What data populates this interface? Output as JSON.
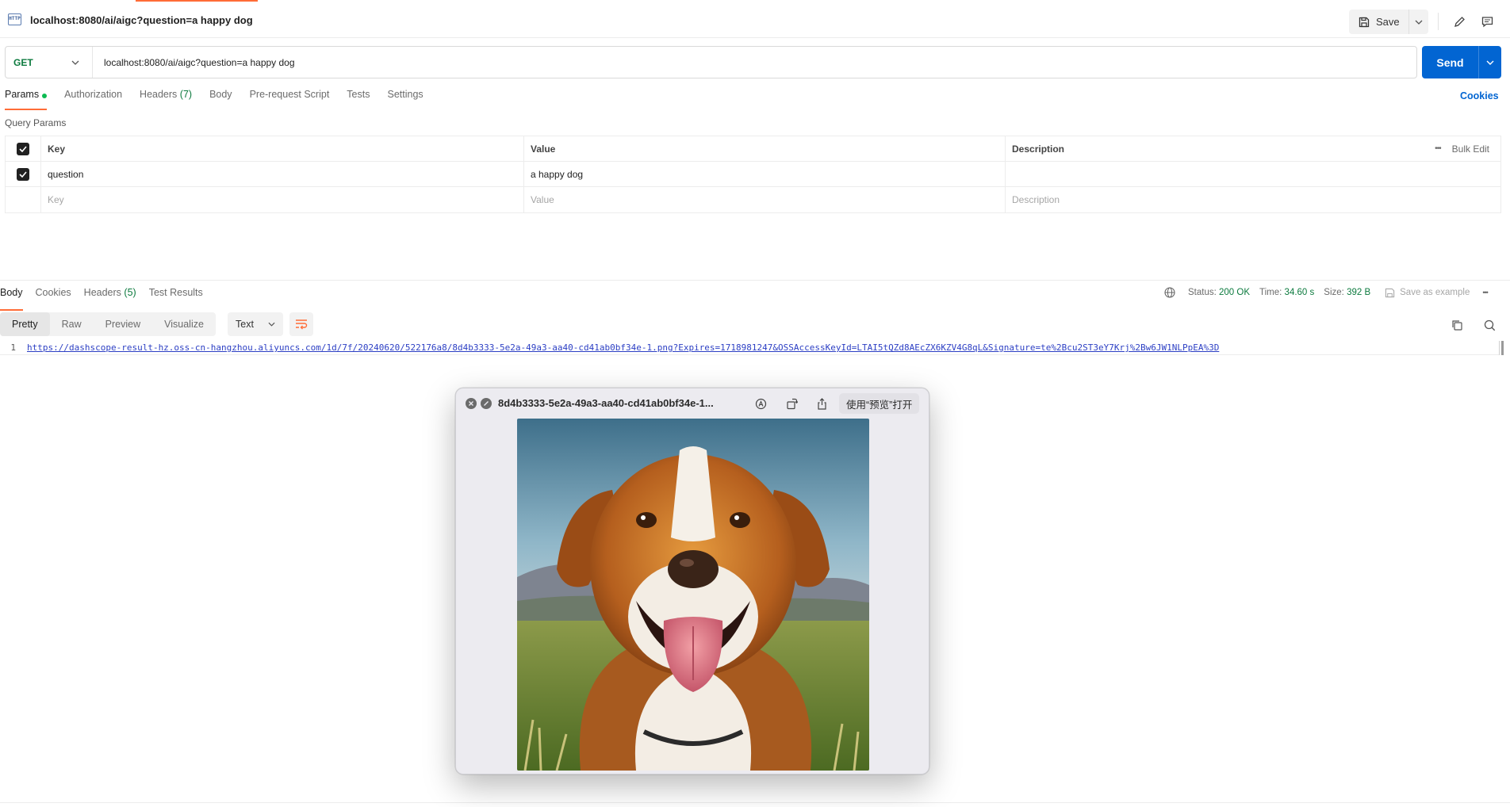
{
  "window": {
    "request_title": "localhost:8080/ai/aigc?question=a happy dog",
    "save_label": "Save",
    "http_icon_text": "HTTP"
  },
  "request": {
    "method": "GET",
    "url": "localhost:8080/ai/aigc?question=a happy dog",
    "send_label": "Send"
  },
  "request_tabs": {
    "params": "Params",
    "authorization": "Authorization",
    "headers": "Headers",
    "headers_count": "(7)",
    "body": "Body",
    "pre_request": "Pre-request Script",
    "tests": "Tests",
    "settings": "Settings",
    "cookies": "Cookies"
  },
  "query_params": {
    "section_label": "Query Params",
    "columns": {
      "key": "Key",
      "value": "Value",
      "description": "Description"
    },
    "bulk_edit": "Bulk Edit",
    "more": "•••",
    "rows": [
      {
        "checked": true,
        "key": "question",
        "value": "a happy dog",
        "description": ""
      }
    ],
    "placeholders": {
      "key": "Key",
      "value": "Value",
      "description": "Description"
    }
  },
  "response_tabs": {
    "body": "Body",
    "cookies": "Cookies",
    "headers": "Headers",
    "headers_count": "(5)",
    "test_results": "Test Results"
  },
  "response_meta": {
    "status_label": "Status:",
    "status_value": "200 OK",
    "time_label": "Time:",
    "time_value": "34.60 s",
    "size_label": "Size:",
    "size_value": "392 B",
    "save_example": "Save as example",
    "more": "•••"
  },
  "view_tabs": {
    "pretty": "Pretty",
    "raw": "Raw",
    "preview": "Preview",
    "visualize": "Visualize",
    "format": "Text"
  },
  "response_body": {
    "line_number": "1",
    "url": "https://dashscope-result-hz.oss-cn-hangzhou.aliyuncs.com/1d/7f/20240620/522176a8/8d4b3333-5e2a-49a3-aa40-cd41ab0bf34e-1.png?Expires=1718981247&OSSAccessKeyId=LTAI5tQZd8AEcZX6KZV4G8qL&Signature=te%2Bcu2ST3eY7Krj%2Bw6JW1NLPpEA%3D"
  },
  "preview_popup": {
    "filename": "8d4b3333-5e2a-49a3-aa40-cd41ab0bf34e-1...",
    "open_with": "使用“预览”打开",
    "image_subject": "happy-dog-photo"
  },
  "colors": {
    "accent_orange": "#ff6c37",
    "send_blue": "#0265d2",
    "method_green": "#0c7a3e",
    "link_blue": "#2c3fc4"
  }
}
